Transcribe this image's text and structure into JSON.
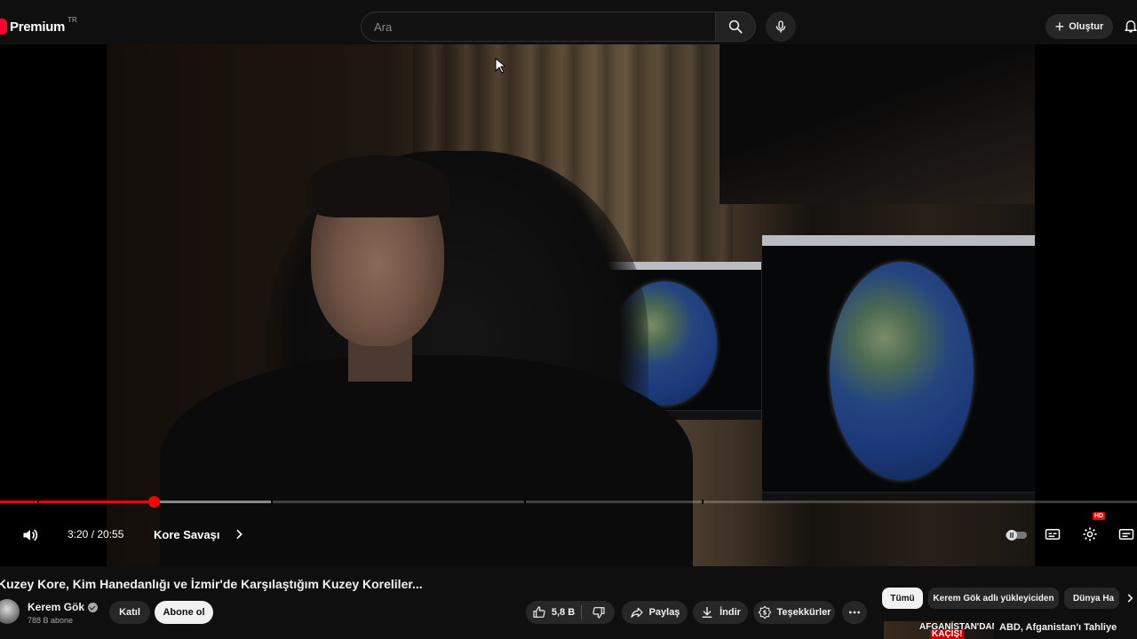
{
  "masthead": {
    "logo_text": "Premium",
    "logo_region": "TR",
    "search_placeholder": "Ara",
    "create_label": "Oluştur"
  },
  "player": {
    "time_current": "3:20",
    "time_separator": " / ",
    "time_total": "20:55",
    "chapter_title": "Kore Savaşı",
    "progress_fraction": 0.135,
    "buffered_fraction": 0.24,
    "hd_badge": "HD"
  },
  "video": {
    "title": "Kuzey Kore, Kim Hanedanlığı ve İzmir'de Karşılaştığım Kuzey Koreliler...",
    "channel_name": "Kerem Gök",
    "subscribers": "788 B abone",
    "join_label": "Katıl",
    "subscribe_label": "Abone ol",
    "like_count": "5,8 B",
    "share_label": "Paylaş",
    "download_label": "İndir",
    "thanks_label": "Teşekkürler"
  },
  "chips": [
    "Tümü",
    "Kerem Gök adlı yükleyiciden",
    "Dünya Ha"
  ],
  "recommendation": {
    "thumb_line1": "AFGANİSTAN'DAN",
    "thumb_line2": "KAÇIŞ!",
    "title": "ABD, Afganistan'ı Tahliye"
  },
  "colors": {
    "accent": "#ff0000",
    "background": "#0f0f0f",
    "pill": "#272727"
  }
}
